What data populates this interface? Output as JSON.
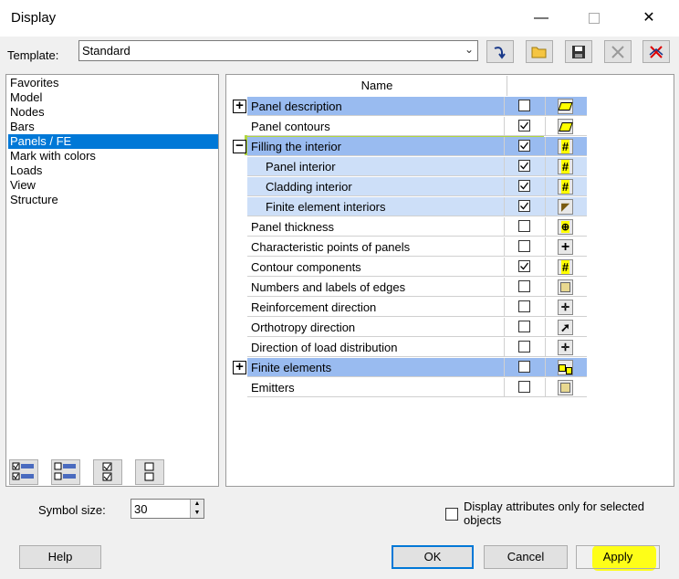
{
  "window": {
    "title": "Display",
    "minimize": "—",
    "close": "✕"
  },
  "template": {
    "label": "Template:",
    "value": "Standard"
  },
  "categories": [
    "Favorites",
    "Model",
    "Nodes",
    "Bars",
    "Panels / FE",
    "Mark with colors",
    "Loads",
    "View",
    "Structure"
  ],
  "selected_category": "Panels / FE",
  "table": {
    "header": "Name",
    "rows": [
      {
        "label": "Panel description",
        "checked": false,
        "style": "group",
        "expander": "+",
        "icon": "panel-description-icon"
      },
      {
        "label": "Panel contours",
        "checked": true,
        "style": "normal",
        "icon": "panel-contour-icon"
      },
      {
        "label": "Filling the interior",
        "checked": true,
        "style": "group",
        "expander": "−",
        "icon": "hatch-icon"
      },
      {
        "label": "Panel interior",
        "checked": true,
        "style": "sub",
        "icon": "hatch-icon"
      },
      {
        "label": "Cladding interior",
        "checked": true,
        "style": "sub",
        "icon": "hatch-icon"
      },
      {
        "label": "Finite element interiors",
        "checked": true,
        "style": "sub",
        "icon": "brush-icon"
      },
      {
        "label": "Panel thickness",
        "checked": false,
        "style": "normal",
        "icon": "thickness-icon"
      },
      {
        "label": "Characteristic points of panels",
        "checked": false,
        "style": "normal",
        "icon": "cross-icon"
      },
      {
        "label": "Contour components",
        "checked": true,
        "style": "normal",
        "icon": "hatch-icon"
      },
      {
        "label": "Numbers and labels of edges",
        "checked": false,
        "style": "normal",
        "icon": "square-icon"
      },
      {
        "label": "Reinforcement direction",
        "checked": false,
        "style": "normal",
        "icon": "arrows-icon"
      },
      {
        "label": "Orthotropy direction",
        "checked": false,
        "style": "normal",
        "icon": "diagonal-arrow-icon"
      },
      {
        "label": "Direction of load distribution",
        "checked": false,
        "style": "normal",
        "icon": "arrows-icon"
      },
      {
        "label": "Finite elements",
        "checked": false,
        "style": "group",
        "expander": "+",
        "icon": "finite-elements-icon"
      },
      {
        "label": "Emitters",
        "checked": false,
        "style": "normal",
        "icon": "square-icon"
      }
    ]
  },
  "symbol_size": {
    "label": "Symbol size:",
    "value": "30"
  },
  "display_attributes": {
    "label": "Display attributes only for selected objects",
    "checked": false
  },
  "buttons": {
    "help": "Help",
    "ok": "OK",
    "cancel": "Cancel",
    "apply": "Apply"
  },
  "colors": {
    "selection": "#0078d7",
    "group_row": "#99bbf0",
    "sub_row": "#cddff8",
    "highlight_green": "#96c800",
    "highlight_yellow": "#ffff00"
  }
}
